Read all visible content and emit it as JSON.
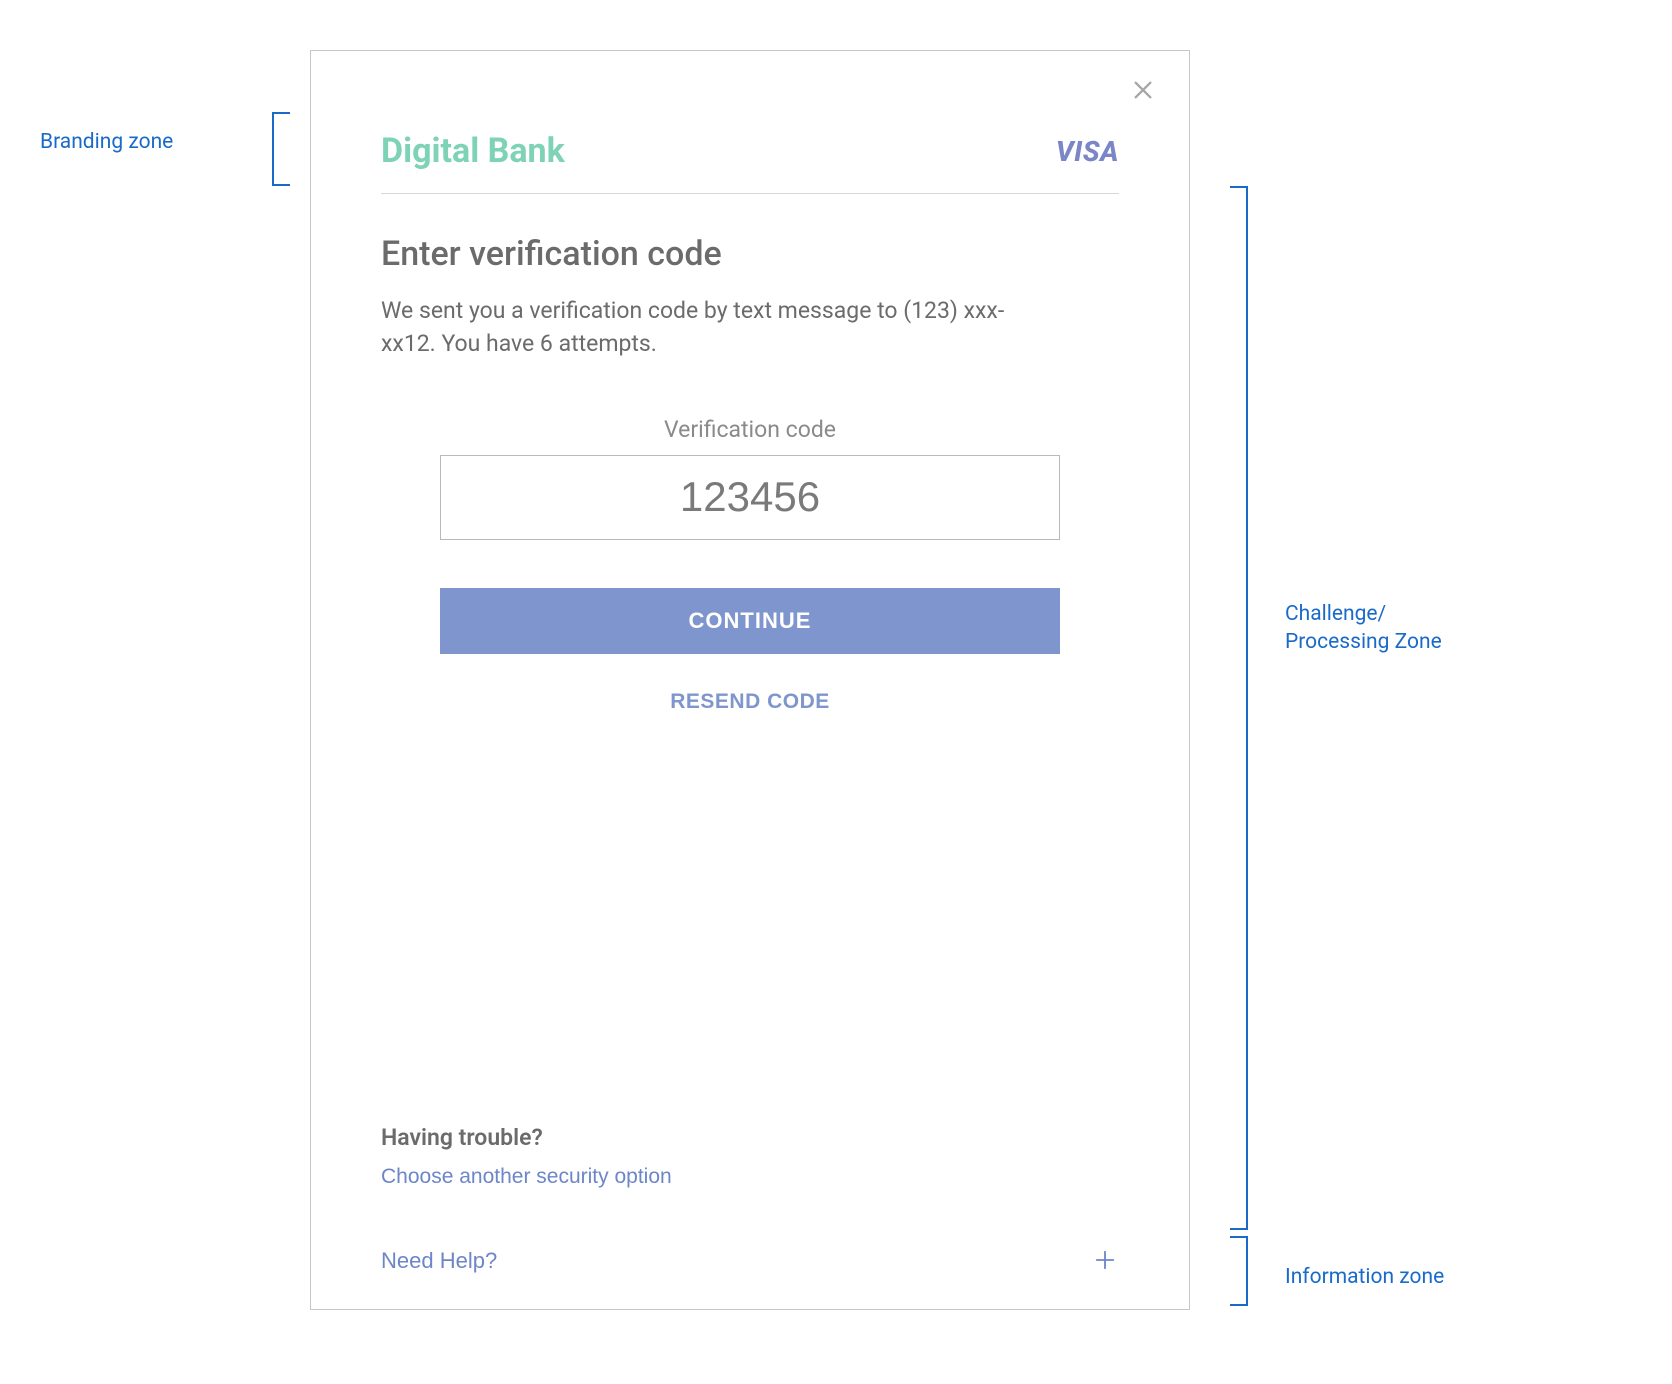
{
  "branding": {
    "bank_name": "Digital Bank",
    "network_name": "VISA"
  },
  "challenge": {
    "title": "Enter verification code",
    "description": "We sent you a verification code by text message to (123) xxx-xx12. You have 6 attempts.",
    "code_label": "Verification code",
    "code_value": "123456",
    "continue_label": "CONTINUE",
    "resend_label": "RESEND CODE",
    "trouble_title": "Having trouble?",
    "trouble_link": "Choose another security option"
  },
  "info": {
    "help_label": "Need Help?"
  },
  "zones": {
    "branding": "Branding zone",
    "challenge_line1": "Challenge/",
    "challenge_line2": "Processing Zone",
    "information": "Information zone"
  },
  "colors": {
    "bank_brand": "#7ed2b6",
    "visa": "#7a86c5",
    "primary_button": "#7f95cd",
    "link": "#6c86c8",
    "annotation": "#1a6bc9"
  }
}
